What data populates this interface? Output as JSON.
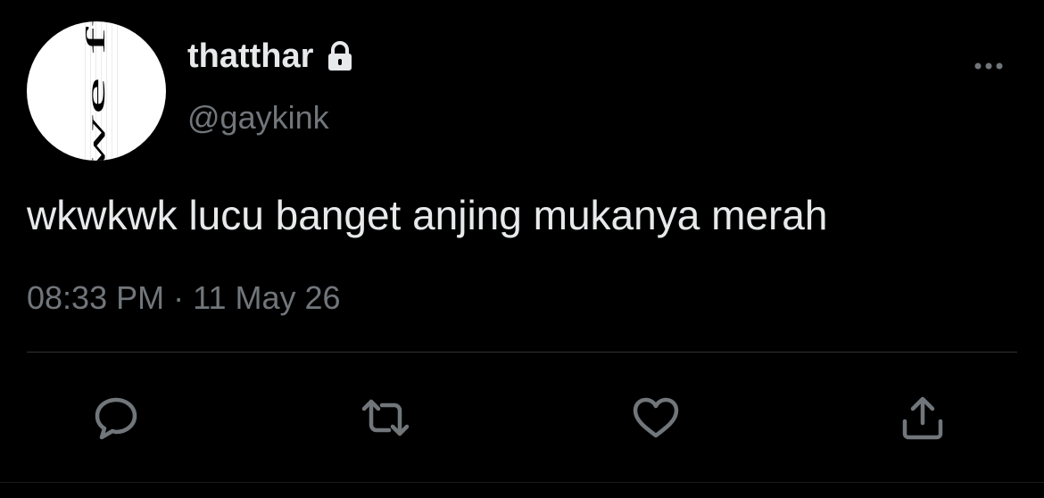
{
  "avatar": {
    "text": "can we fuck?"
  },
  "user": {
    "display_name": "thatthar",
    "handle": "@gaykink",
    "protected_icon": "lock-icon"
  },
  "tweet": {
    "text": "wkwkwk lucu banget anjing mukanya merah",
    "time": "08:33 PM",
    "separator": "·",
    "date": "11 May 26"
  },
  "actions": [
    {
      "name": "reply",
      "icon": "comment-icon"
    },
    {
      "name": "retweet",
      "icon": "retweet-icon"
    },
    {
      "name": "like",
      "icon": "heart-icon"
    },
    {
      "name": "share",
      "icon": "share-icon"
    }
  ],
  "colors": {
    "background": "#000000",
    "primary_text": "#e7e9ea",
    "secondary_text": "#71767b",
    "divider": "#2f3336"
  }
}
